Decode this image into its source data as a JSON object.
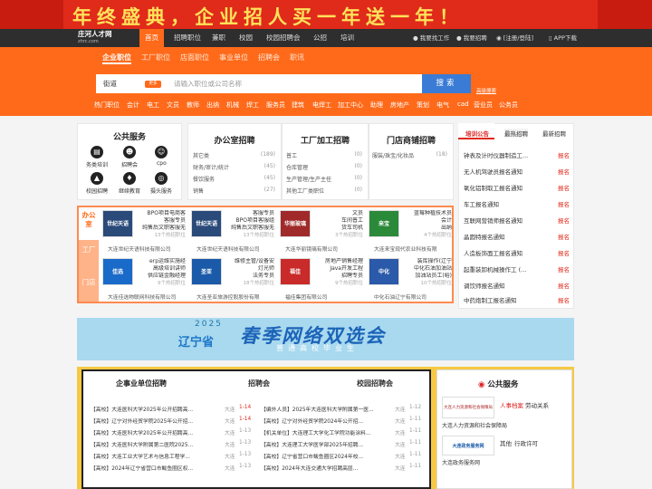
{
  "banner": {
    "text": "年终盛典，企业招人买一年送一年！",
    "color_bg": "#e02a1a",
    "color_text": "#ffe25a"
  },
  "nav": {
    "logo_name": "庄河人才网",
    "logo_domain": "zhrc.com",
    "items": [
      "首页",
      "招聘职位",
      "兼职",
      "校园",
      "校园招聘会",
      "公招",
      "培训"
    ],
    "right": [
      "我要找工作",
      "我要招聘",
      "[注册/登陆]",
      "APP下载"
    ]
  },
  "categories": [
    "企业职位",
    "工厂职位",
    "店面职位",
    "事业单位",
    "招聘会",
    "职讯"
  ],
  "search": {
    "city": "街道",
    "switch": "更多",
    "placeholder": "请输入职位或公司名称",
    "button": "搜索",
    "advanced": "高级搜索"
  },
  "jobs": [
    "热门职位",
    "会计",
    "电工",
    "文员",
    "教师",
    "出纳",
    "机械",
    "焊工",
    "服务员",
    "建筑",
    "电焊工",
    "加工中心",
    "助理",
    "房地产",
    "策划",
    "电气",
    "cad",
    "营业员",
    "公务员"
  ],
  "public_service": {
    "title": "公共服务",
    "items": [
      {
        "label": "务类培训",
        "icon": "book-icon"
      },
      {
        "label": "招聘会",
        "icon": "people-icon"
      },
      {
        "label": "cpo",
        "icon": "group-icon"
      },
      {
        "label": "校园招聘",
        "icon": "graduation-icon"
      },
      {
        "label": "继续教育",
        "icon": "education-icon"
      },
      {
        "label": "摄头服务",
        "icon": "camera-icon"
      }
    ]
  },
  "office": {
    "title": "办公室招聘",
    "rows": [
      {
        "name": "其它类",
        "count": "(189)"
      },
      {
        "name": "财务/审计/统计",
        "count": "(45)"
      },
      {
        "name": "餐饮服务",
        "count": "(45)"
      },
      {
        "name": "销售",
        "count": "(27)"
      }
    ]
  },
  "factory": {
    "title": "工厂加工招聘",
    "rows": [
      {
        "name": "普工",
        "count": "(0)"
      },
      {
        "name": "仓库管理",
        "count": "(0)"
      },
      {
        "name": "生产管理/生产主任",
        "count": "(0)"
      },
      {
        "name": "其他工厂类职位",
        "count": "(0)"
      }
    ]
  },
  "store": {
    "title": "门店商铺招聘",
    "rows": [
      {
        "name": "服装/珠宝/化妆品",
        "count": "(18)"
      }
    ]
  },
  "announcements": {
    "tabs": [
      "培训公告",
      "最热招聘",
      "最新招聘"
    ],
    "signup": "报名",
    "items": [
      "钟表及计时仪器制造工...",
      "无人机驾驶员报名通知",
      "氧化铝制取工报名通知",
      "车工报名通知",
      "互联网营销师报名通知",
      "晶圆特报名通知",
      "人造板饰面工报名通知",
      "起重装卸机械操作工 (…",
      "调饮师报名通知",
      "中药炮制工报名通知"
    ]
  },
  "biz": {
    "tabs": [
      "办公室",
      "工厂",
      "门店"
    ],
    "companies": [
      {
        "jobs": [
          "BPO项目电商客",
          "客服专员",
          "纯售后文职客服无"
        ],
        "more": "13个热招职位",
        "name": "大连世纪天语科技有限公司",
        "logo": "世纪天语",
        "logo_color": "#2a4a7a"
      },
      {
        "jobs": [
          "客服专员",
          "BPO项目客服组",
          "纯售后文职客服无"
        ],
        "more": "13个热招职位",
        "name": "大连世纪天语科技有限公司",
        "logo": "世纪天语",
        "logo_color": "#2a4a7a"
      },
      {
        "jobs": [
          "文员",
          "车间普工",
          "货车司机"
        ],
        "more": "3个热招职位",
        "name": "大连华丽镜璃有限公司",
        "logo": "华丽玻璃",
        "logo_color": "#a02a2a"
      },
      {
        "jobs": [
          "蓝莓种植技术员",
          "会计",
          "出纳"
        ],
        "more": "4个热招职位",
        "name": "大连来宝现代农业科技有限",
        "logo": "来宝",
        "logo_color": "#2a8a3a"
      },
      {
        "jobs": [
          "erp运维实施经",
          "高级培训讲师",
          "供应链金融经理"
        ],
        "more": "9个热招职位",
        "name": "大连佳选物联网科技有限公司",
        "logo": "佳选",
        "logo_color": "#1a6ac9"
      },
      {
        "jobs": [
          "维修主管/设备安",
          "灯光师",
          "法务专员"
        ],
        "more": "18个热招职位",
        "name": "大连圣亚旅游控股股份有限",
        "logo": "圣亚",
        "logo_color": "#1a5aa9"
      },
      {
        "jobs": [
          "房地产销售经理",
          "Java开发工程",
          "招聘专员"
        ],
        "more": "9个热招职位",
        "name": "福佳集团有限公司",
        "logo": "福佳",
        "logo_color": "#c92a2a"
      },
      {
        "jobs": [
          "装库操作(辽宁",
          "中化石油加油站",
          "加油站员工(峪)"
        ],
        "more": "10个热招职位",
        "name": "中化石油辽宁有限公司",
        "logo": "中化",
        "logo_color": "#2a5aa9"
      }
    ]
  },
  "ad": {
    "year": "2025",
    "province": "辽宁省",
    "headline": "春季网络双选会",
    "subline": "普通高校毕业生"
  },
  "bottom": {
    "tabs": [
      "企事业单位招聘",
      "招聘会",
      "校园招聘会"
    ],
    "left": [
      {
        "title": "【高校】大连医科大学2025年公开招聘高...",
        "city": "大连",
        "date": "1-14",
        "hot": true
      },
      {
        "title": "【高校】辽宁对外经贸学院2025年公开招...",
        "city": "大连",
        "date": "1-14",
        "hot": true
      },
      {
        "title": "【高校】大连医科大学2025年公开招聘高...",
        "city": "大连",
        "date": "1-13",
        "hot": false
      },
      {
        "title": "【高校】大连医科大学附属第二医院2025...",
        "city": "大连",
        "date": "1-13",
        "hot": false
      },
      {
        "title": "【高校】大连工业大学艺术与信息工程学...",
        "city": "大连",
        "date": "1-13",
        "hot": false
      },
      {
        "title": "【高校】2024年辽宁省营口市鲅鱼圈区权...",
        "city": "大连",
        "date": "1-13",
        "hot": false
      }
    ],
    "right": [
      {
        "title": "【编外人员】2025年大连医科大学附属第一医...",
        "city": "大连",
        "date": "1-12"
      },
      {
        "title": "【高校】辽宁对外经贸学院2024年公开招...",
        "city": "大连",
        "date": "1-11"
      },
      {
        "title": "【机关单位】大连理工大学化工学院功能涂料...",
        "city": "大连",
        "date": "1-11"
      },
      {
        "title": "【高校】大连理工大学医学部2025年招聘...",
        "city": "大连",
        "date": "1-11"
      },
      {
        "title": "【高校】辽宁省营口市鲅鱼圈区2024年校...",
        "city": "大连",
        "date": "1-11"
      },
      {
        "title": "【高校】2024年大连交通大学招聘高层...",
        "city": "大连",
        "date": "1-11"
      }
    ]
  },
  "pub": {
    "title": "公共服务",
    "items": [
      {
        "img": "大连人力资源和社会保障局",
        "label1": "人事档案",
        "label2": "劳动关系",
        "caption": "大连人力资源和社会保障局"
      },
      {
        "img": "大连政务服务网",
        "label1": "其他",
        "label2": "行政许可",
        "caption": "大连政务服务网"
      }
    ]
  }
}
